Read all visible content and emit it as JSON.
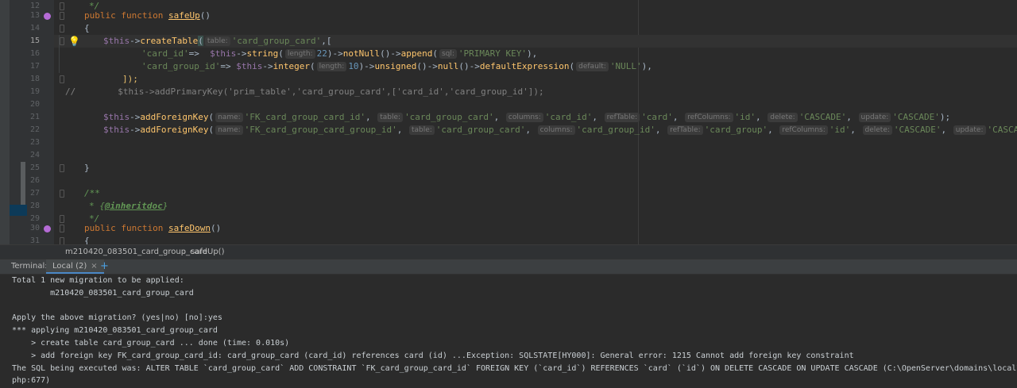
{
  "editor": {
    "line_numbers": [
      "12",
      "13",
      "14",
      "15",
      "16",
      "17",
      "18",
      "19",
      "20",
      "21",
      "22",
      "23",
      "24",
      "25",
      "26",
      "27",
      "28",
      "29",
      "30",
      "31"
    ],
    "l12": {
      "t": "*/"
    },
    "l13": {
      "k1": "public",
      "k2": "function",
      "fn": "safeUp",
      "p": "()"
    },
    "l14": {
      "t": "{"
    },
    "l15": {
      "v": "$this",
      "op": "->",
      "fn": "createTable",
      "p1": "(",
      "h1": "table:",
      "s1": "'card_group_card'",
      "rest": ",["
    },
    "l16": {
      "s1": "'card_id'",
      "op1": "=>  ",
      "v": "$this",
      "op2": "->",
      "fn1": "string",
      "p1": "(",
      "h1": "length:",
      "n1": "22",
      "p2": ")->",
      "fn2": "notNull",
      "p3": "()->",
      "fn3": "append",
      "p4": "(",
      "h2": "sql:",
      "s2": "'PRIMARY KEY'",
      "p5": "),"
    },
    "l17": {
      "s1": "'card_group_id'",
      "op1": "=> ",
      "v": "$this",
      "op2": "->",
      "fn1": "integer",
      "p1": "(",
      "h1": "length:",
      "n1": "10",
      "p2": ")->",
      "fn2": "unsigned",
      "p3": "()->",
      "fn3": "null",
      "p4": "()->",
      "fn4": "defaultExpression",
      "p5": "(",
      "h2": "default:",
      "s2": "'NULL'",
      "p6": "),"
    },
    "l18": {
      "t": "]);"
    },
    "l19": {
      "t": "//        $this->addPrimaryKey('prim_table','card_group_card',['card_id','card_group_id']);"
    },
    "l21": {
      "v": "$this",
      "op": "->",
      "fn": "addForeignKey",
      "p": "(",
      "h1": "name:",
      "s1": "'FK_card_group_card_id'",
      "h2": "table:",
      "s2": "'card_group_card'",
      "h3": "columns:",
      "s3": "'card_id'",
      "h4": "refTable:",
      "s4": "'card'",
      "h5": "refColumns:",
      "s5": "'id'",
      "h6": "delete:",
      "s6": "'CASCADE'",
      "h7": "update:",
      "s7": "'CASCADE'",
      "end": ");"
    },
    "l22": {
      "v": "$this",
      "op": "->",
      "fn": "addForeignKey",
      "p": "(",
      "h1": "name:",
      "s1": "'FK_card_group_card_group_id'",
      "h2": "table:",
      "s2": "'card_group_card'",
      "h3": "columns:",
      "s3": "'card_group_id'",
      "h4": "refTable:",
      "s4": "'card_group'",
      "h5": "refColumns:",
      "s5": "'id'",
      "h6": "delete:",
      "s6": "'CASCADE'",
      "h7": "update:",
      "s7": "'CASCADE'",
      "end": ");"
    },
    "l25": {
      "t": "}"
    },
    "l27": {
      "t": "/**"
    },
    "l28": {
      "star": "* {",
      "tag": "@inheritdoc",
      "close": "}"
    },
    "l29": {
      "t": "*/"
    },
    "l30": {
      "k1": "public",
      "k2": "function",
      "fn": "safeDown",
      "p": "()"
    },
    "l31": {
      "t": "{"
    }
  },
  "breadcrumb": {
    "file": "m210420_083501_card_group_card",
    "method": "safeUp()"
  },
  "terminal": {
    "label": "Terminal:",
    "tab_label": "Local (2)",
    "close": "×",
    "add": "+",
    "lines": [
      "Total 1 new migration to be applied:",
      "        m210420_083501_card_group_card",
      "",
      "Apply the above migration? (yes|no) [no]:yes",
      "*** applying m210420_083501_card_group_card",
      "    > create table card_group_card ... done (time: 0.010s)",
      "    > add foreign key FK_card_group_card_id: card_group_card (card_id) references card (id) ...Exception: SQLSTATE[HY000]: General error: 1215 Cannot add foreign key constraint",
      "The SQL being executed was: ALTER TABLE `card_group_card` ADD CONSTRAINT `FK_card_group_card_id` FOREIGN KEY (`card_id`) REFERENCES `card` (`id`) ON DELETE CASCADE ON UPDATE CASCADE (C:\\OpenServer\\domains\\local\\",
      "php:677)"
    ]
  },
  "colors": {
    "background": "#2b2b2b",
    "keyword": "#cc7832",
    "function": "#ffc66d",
    "string": "#6a8759",
    "variable": "#9876aa",
    "number": "#6897bb",
    "accent": "#4a88c7"
  }
}
